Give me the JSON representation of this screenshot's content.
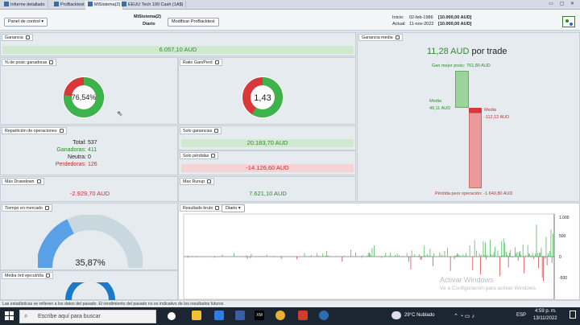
{
  "tabs": [
    "Informe detallado",
    "ProBacktest",
    "MiSistema(2)",
    "EEUU Tech 100 Cash (1A$)"
  ],
  "header": {
    "panel_dropdown": "Panel de control",
    "system_name": "MiSistema(2)",
    "timeframe": "Diario",
    "modify_button": "Modificar ProBacktest",
    "start_label": "Inicio:",
    "start_value": "02-feb-1986",
    "start_capital": "[10.000,00 AUD]",
    "actual_label": "Actual:",
    "actual_value": "11-nov-2022",
    "actual_capital": "[10.000,00 AUD]"
  },
  "panels": {
    "ganancia": {
      "title": "Ganancia",
      "value": "6.057,10 AUD"
    },
    "pct_ganadoras": {
      "title": "% de posic ganadoras",
      "value": "76,54%",
      "fraction": 0.7654
    },
    "ratio": {
      "title": "Ratio Gan/Perd",
      "value": "1,43",
      "fraction": 0.5885
    },
    "ganancia_media": {
      "title": "Ganancia media",
      "value": "11,28 AUD",
      "suffix": "por trade",
      "best_label": "Gan mejor posic: 761,80 AUD",
      "media_pos_label": "Media",
      "media_pos_value": "49,11 AUD",
      "media_neg_label": "Media",
      "media_neg_value": "-112,12 AUD",
      "worst_label": "Pérdida peor operación: -1.640,80 AUD"
    },
    "reparticion": {
      "title": "Repartición de operaciones",
      "total_label": "Total:",
      "total": "537",
      "gan_label": "Ganadoras:",
      "gan": "411",
      "neutra_label": "Neutra:",
      "neutra": "0",
      "perd_label": "Perdedoras:",
      "perd": "126"
    },
    "solo_ganancias": {
      "title": "Solo ganancias",
      "value": "20.183,70 AUD"
    },
    "solo_perdidas": {
      "title": "Solo pérdidas",
      "value": "-14.126,60 AUD"
    },
    "max_drawdown": {
      "title": "Máx Drawdown",
      "value": "-2.929,70 AUD"
    },
    "max_runup": {
      "title": "Max Runup",
      "value": "7.621,10 AUD"
    },
    "tiempo": {
      "title": "Tiempo en mercado",
      "value": "35,87%",
      "fraction": 0.3587
    },
    "resultado": {
      "title": "Resultado bruto",
      "dropdown": "Diario",
      "yticks": [
        "1.000",
        "500",
        "0",
        "-500"
      ]
    },
    "media_ord": {
      "title": "Media órd ejecut/día"
    }
  },
  "watermark": {
    "line1": "Activar Windows",
    "line2": "Ve a Configuración para activar Windows."
  },
  "status": "Las estadísticas se refieren a los datos del pasado. El rendimiento del pasado no es indicativo de los resultados futuros",
  "taskbar": {
    "search_placeholder": "Escribe aquí para buscar",
    "weather": "29°C  Nublado",
    "lang": "ESP",
    "time": "4:59 p. m.",
    "date": "13/11/2022"
  },
  "colors": {
    "green": "#3cb44b",
    "red": "#d9383a",
    "blue": "#5aa0e6"
  }
}
